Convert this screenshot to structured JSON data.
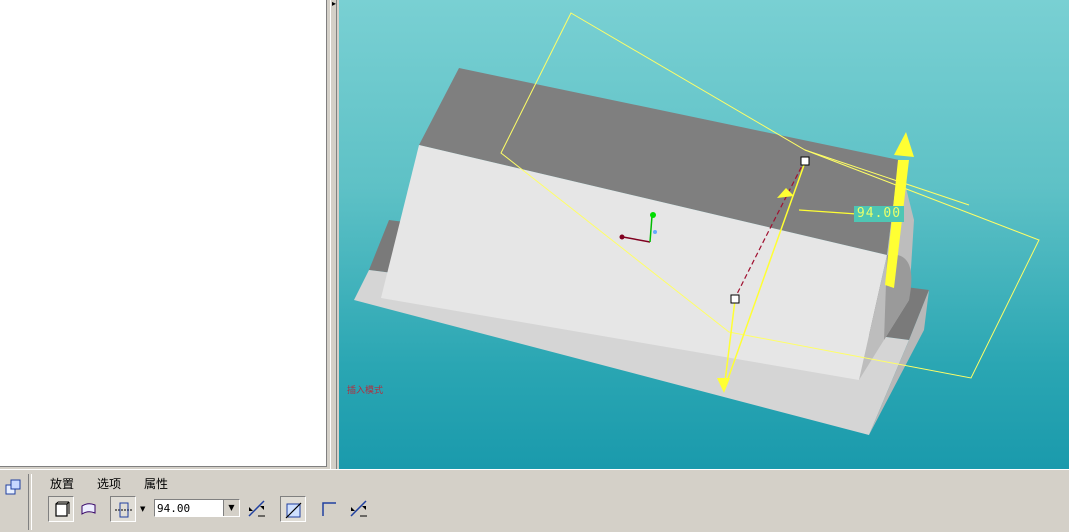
{
  "viewport": {
    "dimension_value": "94.00",
    "mode_label": "插入模式"
  },
  "dashboard": {
    "tabs": [
      {
        "label": "放置"
      },
      {
        "label": "选项"
      },
      {
        "label": "属性"
      }
    ],
    "depth_value": "94.00"
  },
  "colors": {
    "background_top": "#79d0d3",
    "background_bottom": "#1a9aac",
    "model_top_face": "#7f7f7f",
    "model_front_face": "#e6e6e6",
    "sketch_plane": "#ffff66",
    "direction_arrow": "#ffff33",
    "dimension_label_bg": "#4ec6b4"
  },
  "icons": [
    "feature-icon",
    "solid-icon",
    "surface-icon",
    "depth-option-icon",
    "flip-direction-icon",
    "remove-material-icon",
    "thicken-sketch-icon",
    "flip-side-icon"
  ]
}
